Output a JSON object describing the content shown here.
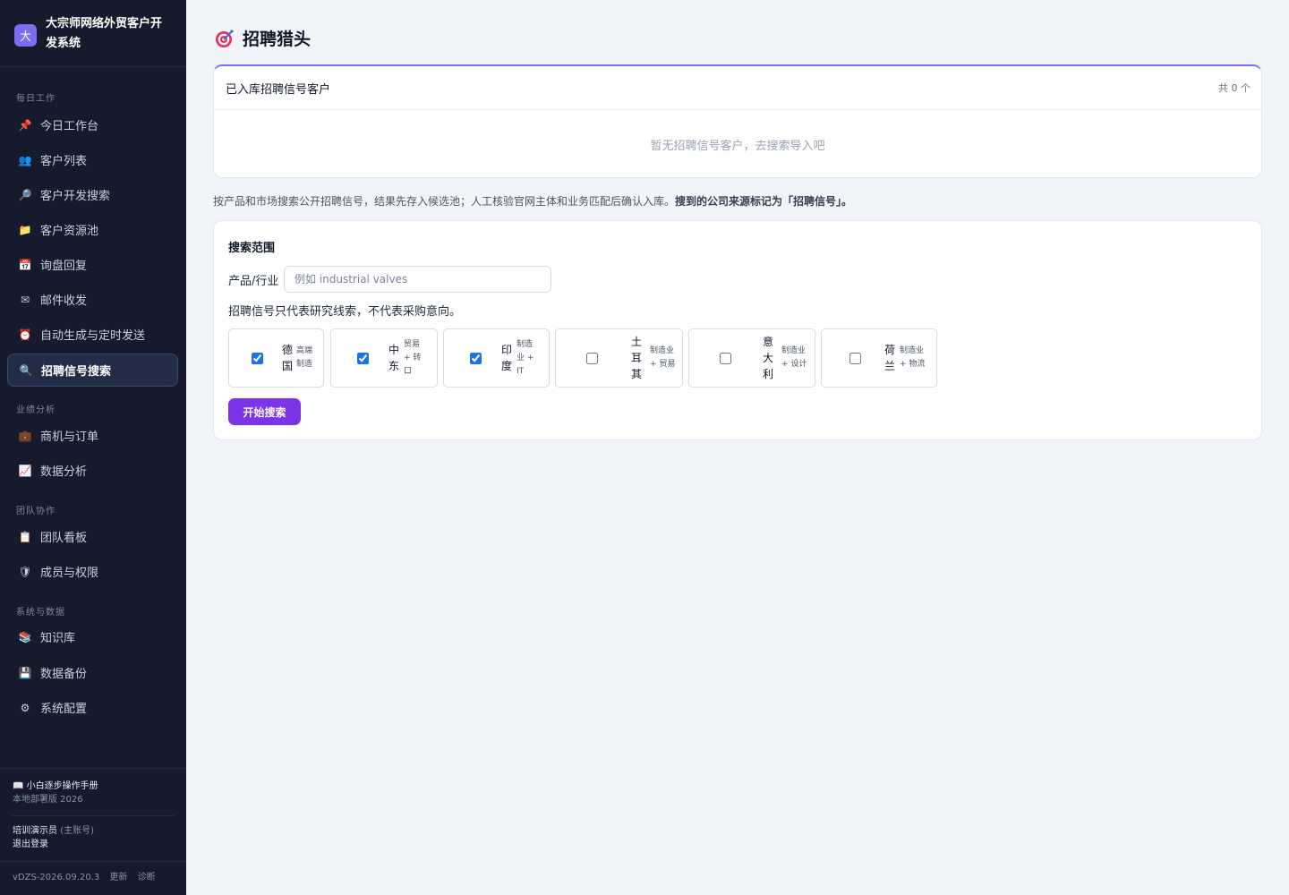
{
  "brand": {
    "logo": "大",
    "title": "大宗师网络外贸客户开发系统"
  },
  "nav": {
    "groups": [
      "每日工作",
      "业绩分析",
      "团队协作",
      "系统与数据"
    ],
    "items": [
      {
        "label": "今日工作台",
        "icon": "📌"
      },
      {
        "label": "客户列表",
        "icon": "👥"
      },
      {
        "label": "客户开发搜索",
        "icon": "🔎"
      },
      {
        "label": "客户资源池",
        "icon": "📁"
      },
      {
        "label": "询盘回复",
        "icon": "📅"
      },
      {
        "label": "邮件收发",
        "icon": "✉"
      },
      {
        "label": "自动生成与定时发送",
        "icon": "⏰"
      },
      {
        "label": "招聘信号搜索",
        "icon": "🔍"
      },
      {
        "label": "商机与订单",
        "icon": "💼"
      },
      {
        "label": "数据分析",
        "icon": "📈"
      },
      {
        "label": "团队看板",
        "icon": "📋"
      },
      {
        "label": "成员与权限",
        "icon": "🛡"
      },
      {
        "label": "知识库",
        "icon": "📚"
      },
      {
        "label": "数据备份",
        "icon": "💾"
      },
      {
        "label": "系统配置",
        "icon": "⚙"
      }
    ]
  },
  "footer": {
    "manual": "📖 小白逐步操作手册",
    "edition": "本地部署版 2026",
    "user": "培训演示员",
    "role": "(主账号)",
    "logout": "退出登录",
    "version": "vDZS-2026.09.20.3",
    "update": "更新",
    "diagnose": "诊断"
  },
  "page": {
    "title": "招聘猎头"
  },
  "stored": {
    "title": "已入库招聘信号客户",
    "count": "共 0 个",
    "empty": "暂无招聘信号客户，去搜索导入吧"
  },
  "description": {
    "text": "按产品和市场搜索公开招聘信号，结果先存入候选池；人工核验官网主体和业务匹配后确认入库。",
    "bold": "搜到的公司来源标记为「招聘信号」。"
  },
  "search": {
    "section_title": "搜索范围",
    "product_label": "产品/行业",
    "product_placeholder": "例如 industrial valves",
    "product_value": "",
    "note": "招聘信号只代表研究线索，不代表采购意向。",
    "start_label": "开始搜索",
    "markets": [
      {
        "name": "德国",
        "desc": "高端制造",
        "checked": true
      },
      {
        "name": "中东",
        "desc": "贸易 + 转口",
        "checked": true
      },
      {
        "name": "印度",
        "desc": "制造业 + IT",
        "checked": true
      },
      {
        "name": "土耳其",
        "desc": "制造业 + 贸易",
        "checked": false
      },
      {
        "name": "意大利",
        "desc": "制造业 + 设计",
        "checked": false
      },
      {
        "name": "荷兰",
        "desc": "制造业 + 物流",
        "checked": false
      }
    ]
  },
  "colors": {
    "sidebar_bg": "#151b2c",
    "accent": "#7c6cf2",
    "button": "#7d33e8",
    "page_bg": "#f1f4f9"
  }
}
